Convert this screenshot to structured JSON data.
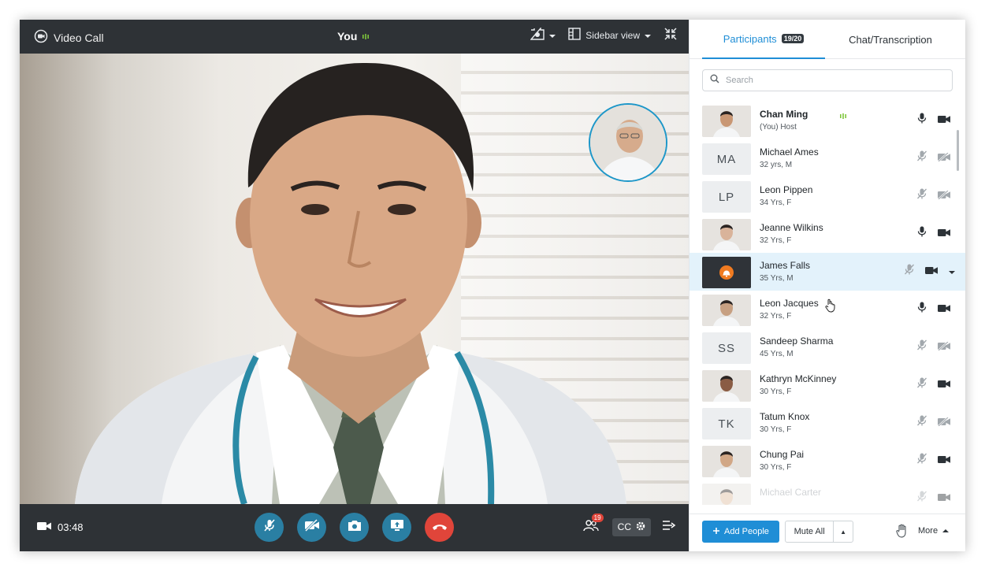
{
  "header": {
    "app_title": "Video Call",
    "you_label": "You",
    "sidebar_view_label": "Sidebar view"
  },
  "call": {
    "timer": "03:48",
    "participants_badge": "19",
    "cc_label": "CC"
  },
  "sidebar": {
    "tabs": {
      "participants": "Participants",
      "participants_count": "19/20",
      "chat": "Chat/Transcription"
    },
    "search_placeholder": "Search",
    "participants": [
      {
        "name": "Chan Ming",
        "info": "(You) Host",
        "initials": "",
        "photo": true,
        "mic": "on",
        "cam": "on"
      },
      {
        "name": "Michael Ames",
        "info": "32 yrs, M",
        "initials": "MA",
        "photo": false,
        "mic": "off",
        "cam": "off"
      },
      {
        "name": "Leon Pippen",
        "info": "34 Yrs, F",
        "initials": "LP",
        "photo": false,
        "mic": "off",
        "cam": "off"
      },
      {
        "name": "Jeanne Wilkins",
        "info": "32 Yrs, F",
        "initials": "",
        "photo": true,
        "mic": "on",
        "cam": "on"
      },
      {
        "name": "James Falls",
        "info": "35 Yrs, M",
        "initials": "",
        "photo": true,
        "mic": "off",
        "cam": "on"
      },
      {
        "name": "Leon Jacques",
        "info": "32 Yrs, F",
        "initials": "",
        "photo": true,
        "mic": "on",
        "cam": "on"
      },
      {
        "name": "Sandeep Sharma",
        "info": "45 Yrs, M",
        "initials": "SS",
        "photo": false,
        "mic": "off",
        "cam": "off"
      },
      {
        "name": "Kathryn McKinney",
        "info": "30 Yrs, F",
        "initials": "",
        "photo": true,
        "mic": "off",
        "cam": "on"
      },
      {
        "name": "Tatum Knox",
        "info": "30 Yrs, F",
        "initials": "TK",
        "photo": false,
        "mic": "off",
        "cam": "off"
      },
      {
        "name": "Chung Pai",
        "info": "30 Yrs, F",
        "initials": "",
        "photo": true,
        "mic": "off",
        "cam": "on"
      },
      {
        "name": "Michael Carter",
        "info": "",
        "initials": "",
        "photo": true,
        "mic": "off",
        "cam": "on"
      }
    ],
    "footer": {
      "add_people": "Add People",
      "mute_all": "Mute All",
      "more": "More"
    }
  },
  "colors": {
    "accent": "#1f8ed6",
    "end_call": "#e0453a",
    "control": "#2a7fa3",
    "audio_level": "#7fc63b"
  },
  "icons": [
    "video-call-logo-icon",
    "audio-level-icon",
    "snapshot-icon",
    "layout-icon",
    "collapse-icon",
    "camera-icon",
    "mic-off-icon",
    "video-off-icon",
    "switch-camera-icon",
    "share-screen-icon",
    "end-call-icon",
    "participants-icon",
    "settings-icon",
    "panel-toggle-icon",
    "search-icon",
    "mic-icon",
    "video-icon",
    "chevron-down-icon",
    "raise-hand-icon",
    "plus-icon"
  ]
}
